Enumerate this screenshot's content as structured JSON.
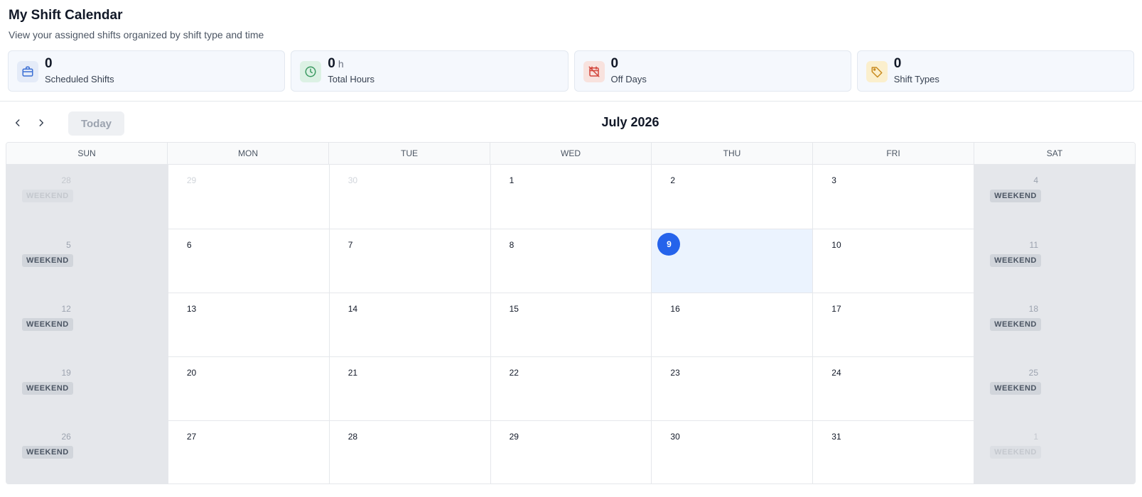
{
  "header": {
    "title": "My Shift Calendar",
    "subtitle": "View your assigned shifts organized by shift type and time"
  },
  "stats": [
    {
      "value": "0",
      "unit": "",
      "label": "Scheduled Shifts",
      "icon": "briefcase-icon",
      "color": "#3b6fd4",
      "bg": "#e4ebf8"
    },
    {
      "value": "0",
      "unit": "h",
      "label": "Total Hours",
      "icon": "clock-icon",
      "color": "#3c9a62",
      "bg": "#dcf1e4"
    },
    {
      "value": "0",
      "unit": "",
      "label": "Off Days",
      "icon": "calendar-off-icon",
      "color": "#d2453b",
      "bg": "#f8e2de"
    },
    {
      "value": "0",
      "unit": "",
      "label": "Shift Types",
      "icon": "tag-icon",
      "color": "#c88a1e",
      "bg": "#fbefcd"
    }
  ],
  "toolbar": {
    "today_label": "Today",
    "month_title": "July 2026"
  },
  "calendar": {
    "weekdays": [
      "SUN",
      "MON",
      "TUE",
      "WED",
      "THU",
      "FRI",
      "SAT"
    ],
    "weekend_label": "WEEKEND",
    "weeks": [
      [
        {
          "d": "28",
          "muted": true
        },
        {
          "d": "29",
          "muted": true
        },
        {
          "d": "30",
          "muted": true
        },
        {
          "d": "1"
        },
        {
          "d": "2"
        },
        {
          "d": "3"
        },
        {
          "d": "4"
        }
      ],
      [
        {
          "d": "5"
        },
        {
          "d": "6"
        },
        {
          "d": "7"
        },
        {
          "d": "8"
        },
        {
          "d": "9",
          "today": true
        },
        {
          "d": "10"
        },
        {
          "d": "11"
        }
      ],
      [
        {
          "d": "12"
        },
        {
          "d": "13"
        },
        {
          "d": "14"
        },
        {
          "d": "15"
        },
        {
          "d": "16"
        },
        {
          "d": "17"
        },
        {
          "d": "18"
        }
      ],
      [
        {
          "d": "19"
        },
        {
          "d": "20"
        },
        {
          "d": "21"
        },
        {
          "d": "22"
        },
        {
          "d": "23"
        },
        {
          "d": "24"
        },
        {
          "d": "25"
        }
      ],
      [
        {
          "d": "26"
        },
        {
          "d": "27"
        },
        {
          "d": "28"
        },
        {
          "d": "29"
        },
        {
          "d": "30"
        },
        {
          "d": "31"
        },
        {
          "d": "1",
          "muted": true
        }
      ]
    ]
  }
}
